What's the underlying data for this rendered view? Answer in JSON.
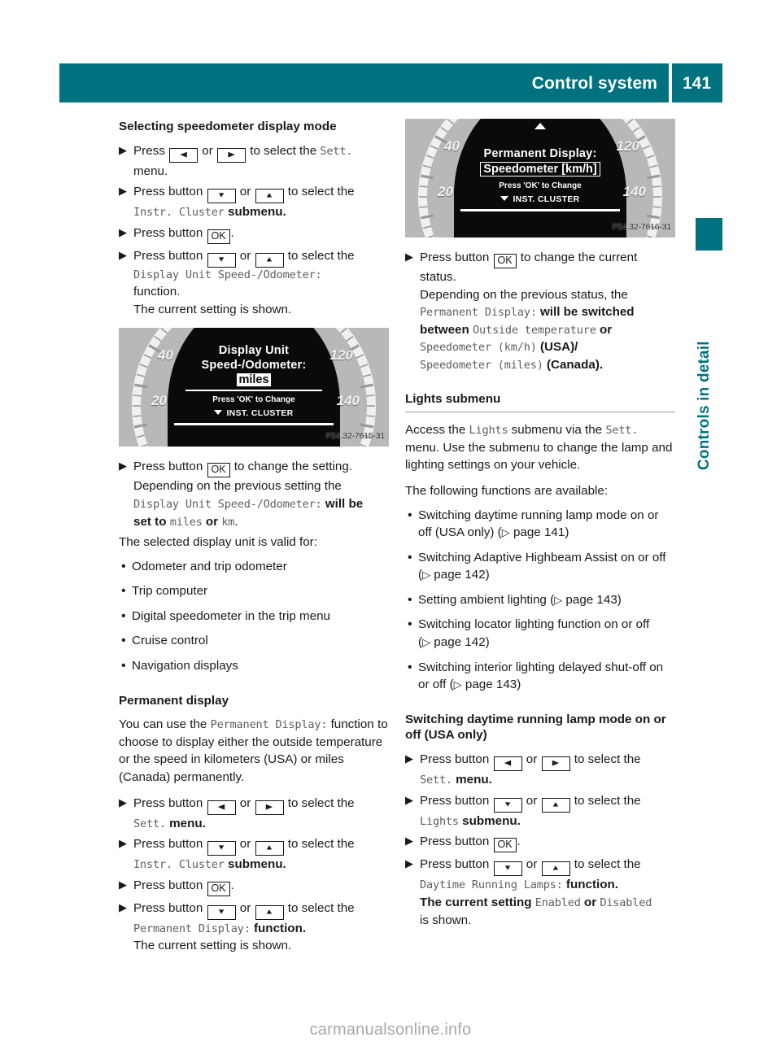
{
  "header": {
    "title": "Control system",
    "page_number": "141"
  },
  "side_tab": {
    "label": "Controls in detail"
  },
  "watermark": "carmanualsonline.info",
  "keys": {
    "left": "◀",
    "right": "▶",
    "down": "▼",
    "up": "▲",
    "ok": "OK"
  },
  "left_column": {
    "heading_speedometer": "Selecting speedometer display mode",
    "steps_speedometer": [
      {
        "lead": "Press",
        "key_a": "left",
        "or": "or",
        "key_b": "right",
        "tail": "to select the",
        "mono": "Sett.",
        "after": "",
        "sub": "menu."
      },
      {
        "lead": "Press button",
        "key_a": "down",
        "or": "or",
        "key_b": "up",
        "tail": "to select the",
        "mono": "Instr. Cluster",
        "after": "submenu."
      },
      {
        "lead": "Press button",
        "key_ok": "OK",
        "tail": "."
      },
      {
        "lead": "Press button",
        "key_a": "down",
        "or": "or",
        "key_b": "up",
        "tail": "to select the",
        "mono": "Display Unit Speed-/Odometer:",
        "after": "function.",
        "sub": "The current setting is shown."
      }
    ],
    "figure_display_unit": {
      "line1": "Display Unit",
      "line2": "Speed-/Odometer:",
      "value": "miles",
      "hint": "Press 'OK' to Change",
      "menu": "INST. CLUSTER",
      "scale": [
        "40",
        "20",
        "120",
        "140"
      ],
      "code": "P54.32-7615-31"
    },
    "step_ok_change": {
      "lead": "Press button",
      "key_ok": "OK",
      "tail": "to change the setting.",
      "sub1": "Depending on the previous setting the",
      "sub1_mono": "Display Unit Speed-/Odometer:",
      "sub1_after": "will be",
      "sub2_pre": "set to",
      "sub2_mono_a": "miles",
      "sub2_mid": "or",
      "sub2_mono_b": "km",
      "sub2_end": "."
    },
    "valid_for_intro": "The selected display unit is valid for:",
    "valid_for_items": [
      "Odometer and trip odometer",
      "Trip computer",
      "Digital speedometer in the trip menu",
      "Cruise control",
      "Navigation displays"
    ],
    "heading_permanent": "Permanent display",
    "permanent_para": {
      "pre": "You can use the",
      "mono": "Permanent Display:",
      "post": "function to choose to display either the outside temperature or the speed in kilometers (USA) or miles (Canada) permanently."
    },
    "steps_permanent": [
      {
        "lead": "Press button",
        "key_a": "left",
        "or": "or",
        "key_b": "right",
        "tail": "to select the",
        "mono": "Sett.",
        "after": "menu."
      },
      {
        "lead": "Press button",
        "key_a": "down",
        "or": "or",
        "key_b": "up",
        "tail": "to select the",
        "mono": "Instr. Cluster",
        "after": "submenu."
      },
      {
        "lead": "Press button",
        "key_ok": "OK",
        "tail": "."
      },
      {
        "lead": "Press button",
        "key_a": "down",
        "or": "or",
        "key_b": "up",
        "tail": "to select the",
        "mono": "Permanent Display:",
        "after": "function.",
        "sub": "The current setting is shown."
      }
    ]
  },
  "right_column": {
    "figure_permanent_display": {
      "line1": "Permanent Display:",
      "value": "Speedometer [km/h]",
      "hint": "Press 'OK' to Change",
      "menu": "INST. CLUSTER",
      "scale": [
        "40",
        "20",
        "120",
        "140"
      ],
      "code": "P54.32-7616-31"
    },
    "step_ok_status": {
      "lead": "Press button",
      "key_ok": "OK",
      "tail": "to change the current",
      "sub0": "status.",
      "sub1": "Depending on the previous status, the",
      "sub2_mono": "Permanent Display:",
      "sub2_after": "will be switched",
      "sub3_pre": "between",
      "sub3_mono": "Outside temperature",
      "sub3_post": "or",
      "sub4_mono": "Speedometer (km/h)",
      "sub4_post": "(USA)/",
      "sub5_mono": "Speedometer (miles)",
      "sub5_post": "(Canada)."
    },
    "heading_lights": "Lights submenu",
    "lights_para": {
      "pre": "Access the",
      "mono_a": "Lights",
      "mid": "submenu via the",
      "mono_b": "Sett.",
      "post": "menu. Use the submenu to change the lamp and lighting settings on your vehicle."
    },
    "functions_intro": "The following functions are available:",
    "functions": [
      {
        "text": "Switching daytime running lamp mode on or off (USA only)",
        "page": "page 141"
      },
      {
        "text": "Switching Adaptive Highbeam Assist on or off",
        "page": "page 142"
      },
      {
        "text": "Setting ambient lighting",
        "page": "page 143"
      },
      {
        "text": "Switching locator lighting function on or off",
        "page": "page 142"
      },
      {
        "text": "Switching interior lighting delayed shut-off on or off",
        "page": "page 143"
      }
    ],
    "heading_drl": "Switching daytime running lamp mode on or off (USA only)",
    "steps_drl": [
      {
        "lead": "Press button",
        "key_a": "left",
        "or": "or",
        "key_b": "right",
        "tail": "to select the",
        "mono": "Sett.",
        "after": "menu."
      },
      {
        "lead": "Press button",
        "key_a": "down",
        "or": "or",
        "key_b": "up",
        "tail": "to select the",
        "mono": "Lights",
        "after": "submenu."
      },
      {
        "lead": "Press button",
        "key_ok": "OK",
        "tail": "."
      },
      {
        "lead": "Press button",
        "key_a": "down",
        "or": "or",
        "key_b": "up",
        "tail": "to select the",
        "mono": "Daytime Running Lamps:",
        "after": "function.",
        "sub_pre": "The current setting",
        "sub_mono_a": "Enabled",
        "sub_mid": "or",
        "sub_mono_b": "Disabled",
        "sub_end": "is shown."
      }
    ]
  }
}
